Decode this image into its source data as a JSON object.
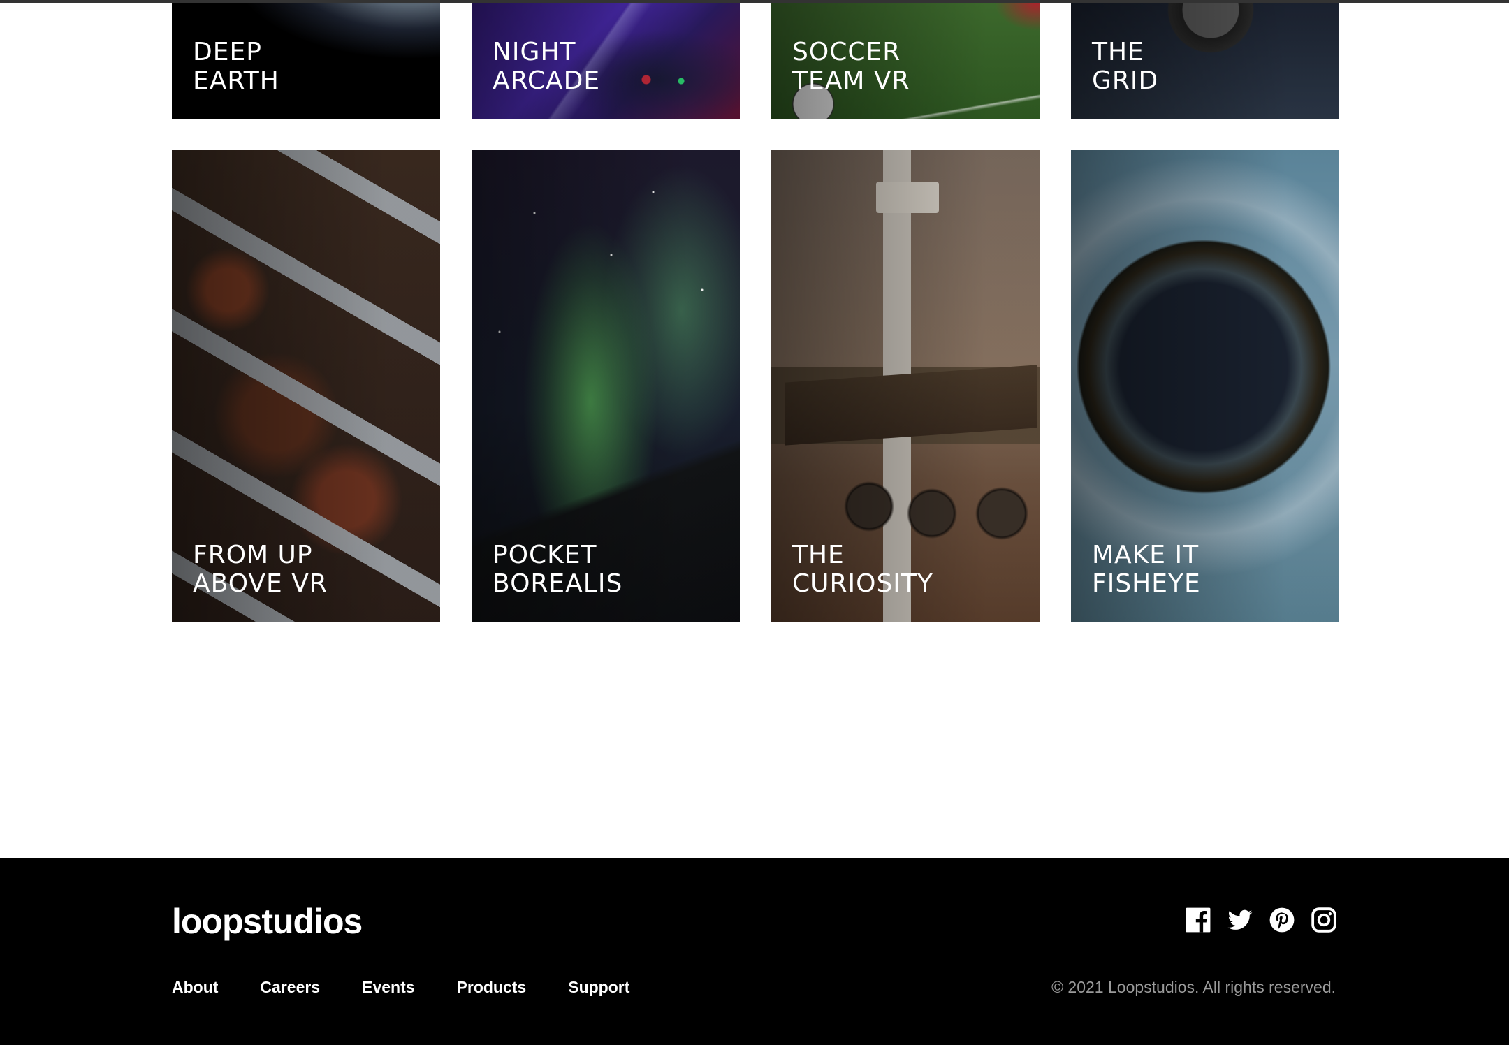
{
  "gallery": {
    "row1": [
      {
        "line1": "DEEP",
        "line2": "EARTH"
      },
      {
        "line1": "NIGHT",
        "line2": "ARCADE"
      },
      {
        "line1": "SOCCER",
        "line2": "TEAM VR"
      },
      {
        "line1": "THE",
        "line2": "GRID"
      }
    ],
    "row2": [
      {
        "line1": "FROM UP",
        "line2": "ABOVE VR"
      },
      {
        "line1": "POCKET",
        "line2": "BOREALIS"
      },
      {
        "line1": "THE",
        "line2": "CURIOSITY"
      },
      {
        "line1": "MAKE IT",
        "line2": "FISHEYE"
      }
    ]
  },
  "footer": {
    "logo": "loopstudios",
    "nav": [
      "About",
      "Careers",
      "Events",
      "Products",
      "Support"
    ],
    "social_icons": [
      "facebook-icon",
      "twitter-icon",
      "pinterest-icon",
      "instagram-icon"
    ],
    "copyright": "© 2021 Loopstudios. All rights reserved."
  },
  "colors": {
    "footer_bg": "#000000",
    "page_bg": "#ffffff",
    "copyright_text": "#9a9a9a"
  }
}
